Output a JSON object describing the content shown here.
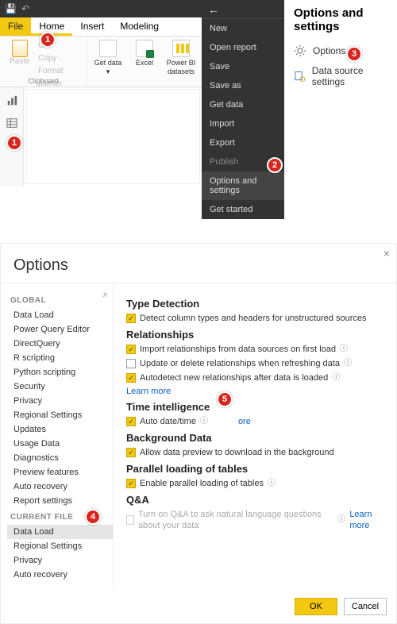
{
  "titlebar": {
    "save_glyph": "💾",
    "undo_glyph": "↶"
  },
  "ribbon": {
    "file": "File",
    "home": "Home",
    "insert": "Insert",
    "modeling": "Modeling",
    "clipboard": {
      "paste": "Paste",
      "cut": "Cut",
      "copy": "Copy",
      "format_painter": "Format painter",
      "group_label": "Clipboard"
    },
    "data": {
      "get_data": "Get data ▾",
      "excel": "Excel",
      "pbi_datasets": "Power BI datasets"
    }
  },
  "filemenu": {
    "back_glyph": "←",
    "items": [
      {
        "label": "New"
      },
      {
        "label": "Open report"
      },
      {
        "label": "Save"
      },
      {
        "label": "Save as"
      },
      {
        "label": "Get data"
      },
      {
        "label": "Import"
      },
      {
        "label": "Export"
      },
      {
        "label": "Publish",
        "disabled": true
      },
      {
        "label": "Options and settings",
        "highlight": true
      },
      {
        "label": "Get started"
      }
    ]
  },
  "side": {
    "heading": "Options and settings",
    "options": "Options",
    "data_source": "Data source settings"
  },
  "callouts": {
    "c1": "1",
    "c2": "2",
    "c3": "3",
    "c4": "4",
    "c5": "5"
  },
  "dialog": {
    "title": "Options",
    "close_glyph": "×",
    "global_head": "GLOBAL",
    "cf_head": "CURRENT FILE",
    "nav_global": [
      "Data Load",
      "Power Query Editor",
      "DirectQuery",
      "R scripting",
      "Python scripting",
      "Security",
      "Privacy",
      "Regional Settings",
      "Updates",
      "Usage Data",
      "Diagnostics",
      "Preview features",
      "Auto recovery",
      "Report settings"
    ],
    "nav_currentfile": [
      "Data Load",
      "Regional Settings",
      "Privacy",
      "Auto recovery"
    ],
    "content": {
      "type_detection": {
        "head": "Type Detection",
        "opt1": "Detect column types and headers for unstructured sources"
      },
      "relationships": {
        "head": "Relationships",
        "opt1": "Import relationships from data sources on first load",
        "opt2": "Update or delete relationships when refreshing data",
        "opt3": "Autodetect new relationships after data is loaded",
        "learn": "Learn more"
      },
      "time_intel": {
        "head": "Time intelligence",
        "opt1": "Auto date/time",
        "learn_fragment": "ore"
      },
      "background": {
        "head": "Background Data",
        "opt1": "Allow data preview to download in the background"
      },
      "parallel": {
        "head": "Parallel loading of tables",
        "opt1": "Enable parallel loading of tables"
      },
      "qa": {
        "head": "Q&A",
        "opt1": "Turn on Q&A to ask natural language questions about your data",
        "learn": "Learn more"
      }
    },
    "ok": "OK",
    "cancel": "Cancel"
  }
}
